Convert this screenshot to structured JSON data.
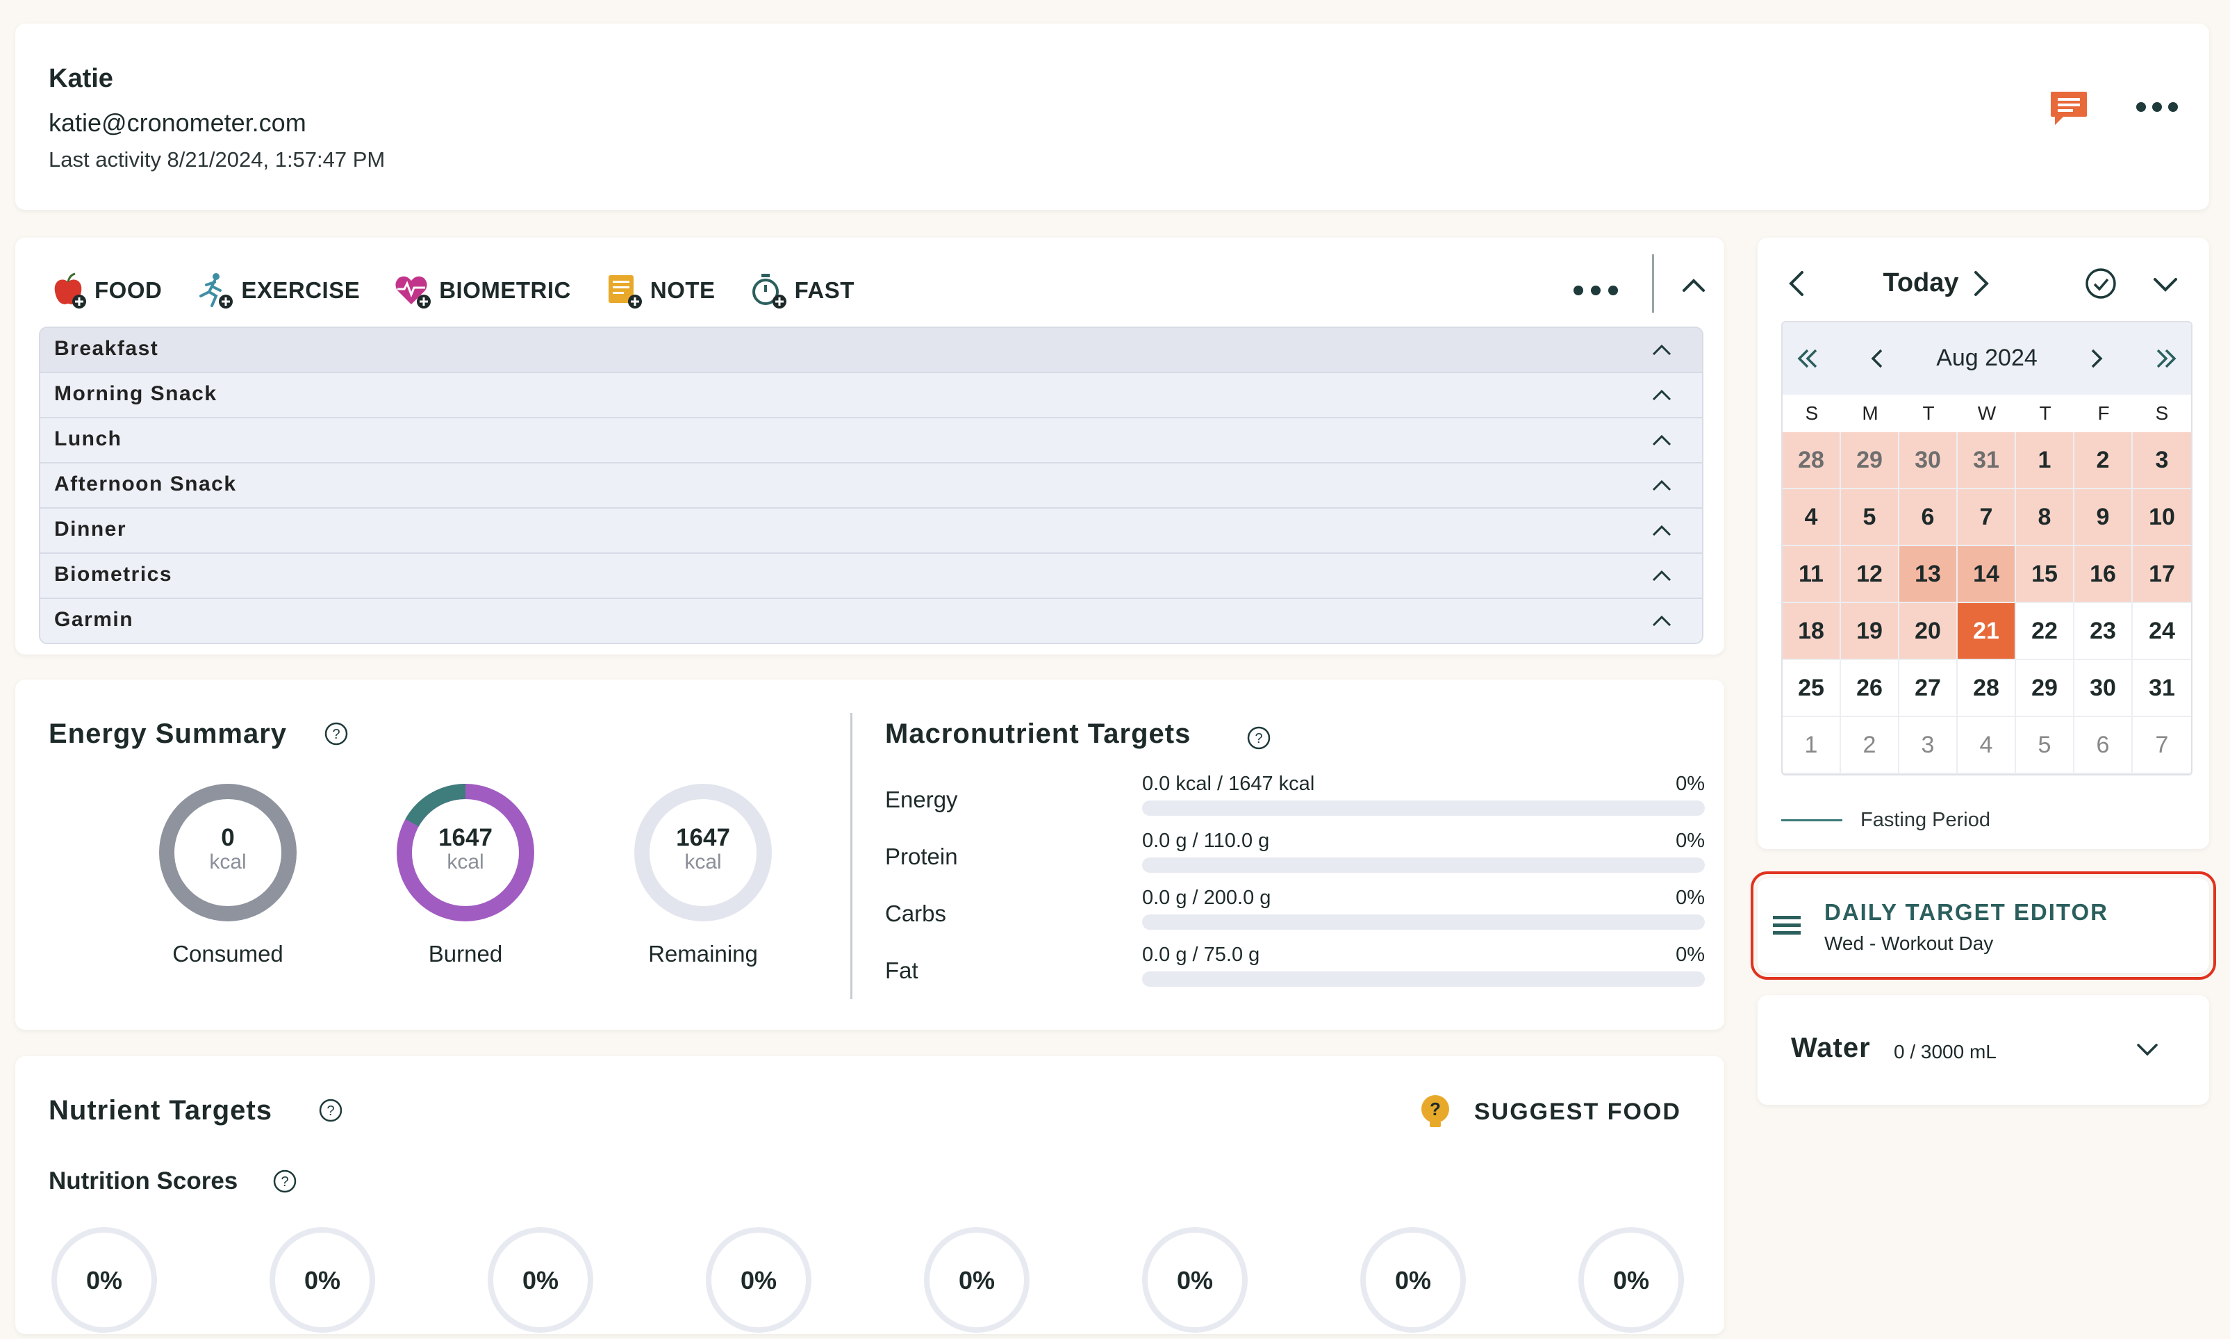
{
  "profile": {
    "name": "Katie",
    "email": "katie@cronometer.com",
    "last_activity": "Last activity 8/21/2024, 1:57:47 PM"
  },
  "diary": {
    "add_items": [
      {
        "label": "FOOD",
        "icon": "apple-add-icon"
      },
      {
        "label": "EXERCISE",
        "icon": "runner-add-icon"
      },
      {
        "label": "BIOMETRIC",
        "icon": "heart-pulse-add-icon"
      },
      {
        "label": "NOTE",
        "icon": "note-add-icon"
      },
      {
        "label": "FAST",
        "icon": "timer-add-icon"
      }
    ],
    "groups": [
      "Breakfast",
      "Morning Snack",
      "Lunch",
      "Afternoon Snack",
      "Dinner",
      "Biometrics",
      "Garmin"
    ]
  },
  "energy": {
    "title": "Energy Summary",
    "consumed": {
      "value": "0",
      "unit": "kcal",
      "label": "Consumed"
    },
    "burned": {
      "value": "1647",
      "unit": "kcal",
      "label": "Burned"
    },
    "remaining": {
      "value": "1647",
      "unit": "kcal",
      "label": "Remaining"
    },
    "colors": {
      "consumed": "#8f939e",
      "burned": "#a15cc2",
      "burned_accent": "#3e7d7b",
      "remaining": "#e3e5ee"
    }
  },
  "macros": {
    "title": "Macronutrient Targets",
    "rows": [
      {
        "name": "Energy",
        "value": "0.0 kcal / 1647 kcal",
        "percent": "0%",
        "fill": 0
      },
      {
        "name": "Protein",
        "value": "0.0 g / 110.0 g",
        "percent": "0%",
        "fill": 0
      },
      {
        "name": "Carbs",
        "value": "0.0 g / 200.0 g",
        "percent": "0%",
        "fill": 0
      },
      {
        "name": "Fat",
        "value": "0.0 g / 75.0 g",
        "percent": "0%",
        "fill": 0
      }
    ]
  },
  "nutrients": {
    "title": "Nutrient Targets",
    "suggest_label": "SUGGEST FOOD",
    "scores_title": "Nutrition Scores",
    "scores": [
      "0%",
      "0%",
      "0%",
      "0%",
      "0%",
      "0%",
      "0%",
      "0%"
    ]
  },
  "calendar": {
    "today_label": "Today",
    "month_label": "Aug 2024",
    "weekdays": [
      "S",
      "M",
      "T",
      "W",
      "T",
      "F",
      "S"
    ],
    "days": [
      {
        "d": "28",
        "s": "prev-month"
      },
      {
        "d": "29",
        "s": "prev-month"
      },
      {
        "d": "30",
        "s": "prev-month"
      },
      {
        "d": "31",
        "s": "prev-month"
      },
      {
        "d": "1",
        "s": "logged"
      },
      {
        "d": "2",
        "s": "logged"
      },
      {
        "d": "3",
        "s": "logged"
      },
      {
        "d": "4",
        "s": "logged"
      },
      {
        "d": "5",
        "s": "logged"
      },
      {
        "d": "6",
        "s": "logged"
      },
      {
        "d": "7",
        "s": "logged"
      },
      {
        "d": "8",
        "s": "logged"
      },
      {
        "d": "9",
        "s": "logged"
      },
      {
        "d": "10",
        "s": "logged"
      },
      {
        "d": "11",
        "s": "logged"
      },
      {
        "d": "12",
        "s": "logged"
      },
      {
        "d": "13",
        "s": "logged-strong"
      },
      {
        "d": "14",
        "s": "logged-strong"
      },
      {
        "d": "15",
        "s": "logged"
      },
      {
        "d": "16",
        "s": "logged"
      },
      {
        "d": "17",
        "s": "logged"
      },
      {
        "d": "18",
        "s": "logged"
      },
      {
        "d": "19",
        "s": "logged"
      },
      {
        "d": "20",
        "s": "logged"
      },
      {
        "d": "21",
        "s": "selected"
      },
      {
        "d": "22",
        "s": ""
      },
      {
        "d": "23",
        "s": ""
      },
      {
        "d": "24",
        "s": ""
      },
      {
        "d": "25",
        "s": ""
      },
      {
        "d": "26",
        "s": ""
      },
      {
        "d": "27",
        "s": ""
      },
      {
        "d": "28",
        "s": ""
      },
      {
        "d": "29",
        "s": ""
      },
      {
        "d": "30",
        "s": ""
      },
      {
        "d": "31",
        "s": ""
      },
      {
        "d": "1",
        "s": "next-month"
      },
      {
        "d": "2",
        "s": "next-month"
      },
      {
        "d": "3",
        "s": "next-month"
      },
      {
        "d": "4",
        "s": "next-month"
      },
      {
        "d": "5",
        "s": "next-month"
      },
      {
        "d": "6",
        "s": "next-month"
      },
      {
        "d": "7",
        "s": "next-month"
      }
    ],
    "legend_label": "Fasting Period"
  },
  "target_editor": {
    "title": "DAILY TARGET EDITOR",
    "subtitle": "Wed - Workout Day"
  },
  "water": {
    "title": "Water",
    "value": "0 / 3000 mL"
  },
  "colors": {
    "accent": "#e8693a",
    "teal": "#2b5f5d",
    "highlight_outline": "#e0331f"
  }
}
